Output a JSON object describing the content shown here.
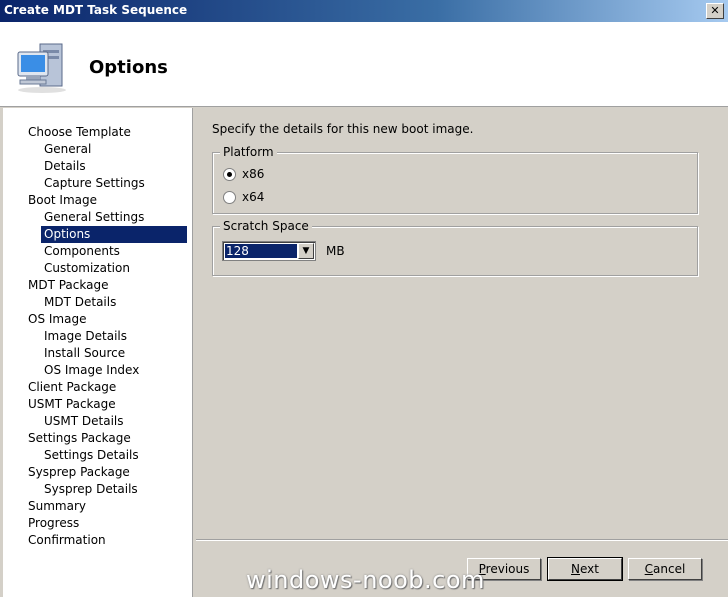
{
  "window": {
    "title": "Create MDT Task Sequence",
    "close_glyph": "✕"
  },
  "header": {
    "title": "Options",
    "icon": "computer-icon"
  },
  "nav": {
    "items": [
      {
        "label": "Choose Template",
        "level": 0
      },
      {
        "label": "General",
        "level": 1
      },
      {
        "label": "Details",
        "level": 1
      },
      {
        "label": "Capture Settings",
        "level": 1
      },
      {
        "label": "Boot Image",
        "level": 0
      },
      {
        "label": "General Settings",
        "level": 1
      },
      {
        "label": "Options",
        "level": 1,
        "selected": true
      },
      {
        "label": "Components",
        "level": 1
      },
      {
        "label": "Customization",
        "level": 1
      },
      {
        "label": "MDT Package",
        "level": 0
      },
      {
        "label": "MDT Details",
        "level": 1
      },
      {
        "label": "OS Image",
        "level": 0
      },
      {
        "label": "Image Details",
        "level": 1
      },
      {
        "label": "Install Source",
        "level": 1
      },
      {
        "label": "OS Image Index",
        "level": 1
      },
      {
        "label": "Client Package",
        "level": 0
      },
      {
        "label": "USMT Package",
        "level": 0
      },
      {
        "label": "USMT Details",
        "level": 1
      },
      {
        "label": "Settings Package",
        "level": 0
      },
      {
        "label": "Settings Details",
        "level": 1
      },
      {
        "label": "Sysprep Package",
        "level": 0
      },
      {
        "label": "Sysprep Details",
        "level": 1
      },
      {
        "label": "Summary",
        "level": 0
      },
      {
        "label": "Progress",
        "level": 0
      },
      {
        "label": "Confirmation",
        "level": 0
      }
    ]
  },
  "main": {
    "instruction": "Specify the details for this new boot image.",
    "platform": {
      "legend": "Platform",
      "options": [
        {
          "label": "x86",
          "checked": true
        },
        {
          "label": "x64",
          "checked": false
        }
      ]
    },
    "scratch": {
      "legend": "Scratch Space",
      "value": "128",
      "unit": "MB"
    }
  },
  "buttons": {
    "previous": "Previous",
    "next": "Next",
    "cancel": "Cancel"
  },
  "watermark": "windows-noob.com",
  "colors": {
    "selection": "#0a246a",
    "dialog_bg": "#d4d0c8",
    "title_bar": "#0a246a"
  }
}
